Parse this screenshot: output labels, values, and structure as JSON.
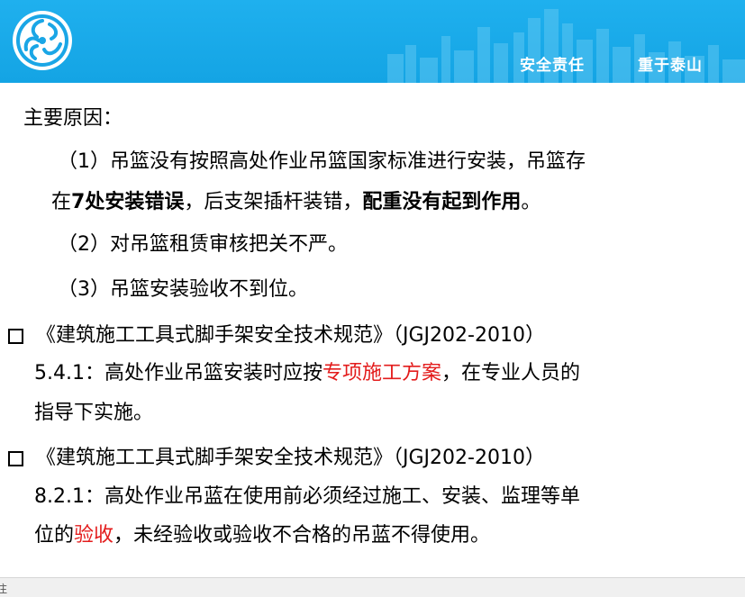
{
  "header": {
    "logo_icon": "company-logo-icon",
    "slogan_1": "安全责任",
    "slogan_2": "重于泰山",
    "background_color": "#14a4e4"
  },
  "main": {
    "heading": "主要原因：",
    "item_1_a": "（1）吊篮没有按照高处作业吊篮国家标准进行安装，吊篮存",
    "item_1_b_prefix": "在",
    "item_1_b_bold1": "7处安装错误",
    "item_1_b_middle": "，后支架插杆装错，",
    "item_1_b_bold2": "配重没有起到作用",
    "item_1_b_suffix": "。",
    "item_2": "（2）对吊篮租赁审核把关不严。",
    "item_3": "（3）吊篮安装验收不到位。"
  },
  "standards": [
    {
      "title": "《建筑施工工具式脚手架安全技术规范》（JGJ202-2010）",
      "line_1_prefix": "5.4.1：高处作业吊篮安装时应按",
      "line_1_red": "专项施工方案",
      "line_1_suffix": "，在专业人员的",
      "line_2": "指导下实施。"
    },
    {
      "title": "《建筑施工工具式脚手架安全技术规范》（JGJ202-2010）",
      "line_1": "8.2.1：高处作业吊蓝在使用前必须经过施工、安装、监理等单",
      "line_2_prefix": "位的",
      "line_2_red": "验收",
      "line_2_suffix": "，未经验收或验收不合格的吊蓝不得使用。"
    }
  ],
  "status_bar": {
    "note": "注"
  },
  "colors": {
    "highlight_red": "#e31c1c",
    "banner_blue": "#14a4e4"
  }
}
